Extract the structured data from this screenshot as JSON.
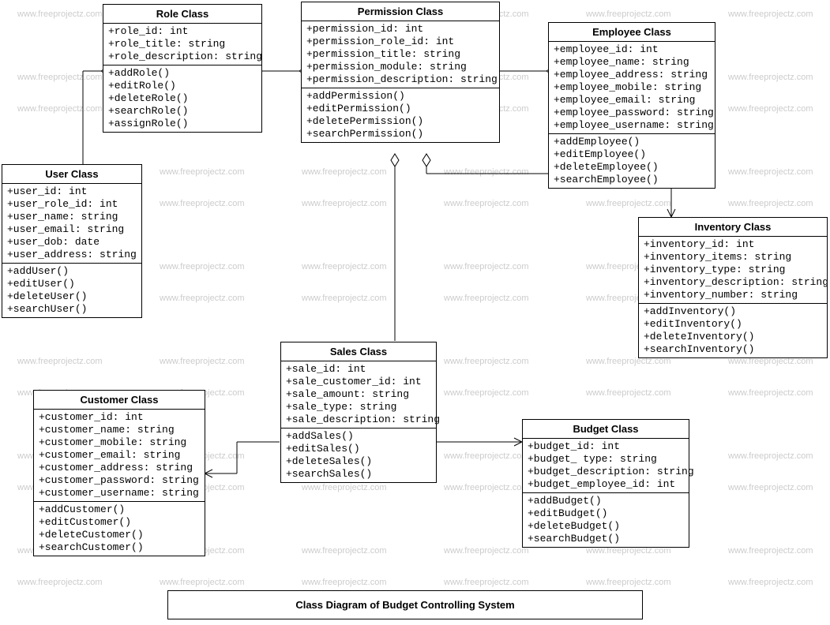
{
  "title": "Class Diagram of Budget Controlling System",
  "watermark": "www.freeprojectz.com",
  "classes": {
    "role": {
      "name": "Role Class",
      "attrs": [
        "+role_id: int",
        "+role_title: string",
        "+role_description: string"
      ],
      "ops": [
        "+addRole()",
        "+editRole()",
        "+deleteRole()",
        "+searchRole()",
        "+assignRole()"
      ]
    },
    "permission": {
      "name": "Permission Class",
      "attrs": [
        "+permission_id: int",
        "+permission_role_id: int",
        "+permission_title: string",
        "+permission_module: string",
        "+permission_description: string"
      ],
      "ops": [
        "+addPermission()",
        "+editPermission()",
        "+deletePermission()",
        "+searchPermission()"
      ]
    },
    "employee": {
      "name": "Employee Class",
      "attrs": [
        "+employee_id: int",
        "+employee_name: string",
        "+employee_address: string",
        "+employee_mobile: string",
        "+employee_email: string",
        "+employee_password: string",
        "+employee_username: string"
      ],
      "ops": [
        "+addEmployee()",
        "+editEmployee()",
        "+deleteEmployee()",
        "+searchEmployee()"
      ]
    },
    "user": {
      "name": "User Class",
      "attrs": [
        "+user_id: int",
        "+user_role_id: int",
        "+user_name: string",
        "+user_email: string",
        "+user_dob: date",
        "+user_address: string"
      ],
      "ops": [
        "+addUser()",
        "+editUser()",
        "+deleteUser()",
        "+searchUser()"
      ]
    },
    "inventory": {
      "name": "Inventory Class",
      "attrs": [
        "+inventory_id: int",
        "+inventory_items: string",
        "+inventory_type: string",
        "+inventory_description: string",
        "+inventory_number: string"
      ],
      "ops": [
        "+addInventory()",
        "+editInventory()",
        "+deleteInventory()",
        "+searchInventory()"
      ]
    },
    "sales": {
      "name": "Sales Class",
      "attrs": [
        "+sale_id: int",
        "+sale_customer_id: int",
        "+sale_amount: string",
        "+sale_type: string",
        "+sale_description: string"
      ],
      "ops": [
        "+addSales()",
        "+editSales()",
        "+deleteSales()",
        "+searchSales()"
      ]
    },
    "customer": {
      "name": "Customer Class",
      "attrs": [
        "+customer_id: int",
        "+customer_name: string",
        "+customer_mobile: string",
        "+customer_email: string",
        "+customer_address: string",
        "+customer_password: string",
        "+customer_username: string"
      ],
      "ops": [
        "+addCustomer()",
        "+editCustomer()",
        "+deleteCustomer()",
        "+searchCustomer()"
      ]
    },
    "budget": {
      "name": "Budget Class",
      "attrs": [
        "+budget_id: int",
        "+budget_ type: string",
        "+budget_description: string",
        "+budget_employee_id: int"
      ],
      "ops": [
        "+addBudget()",
        "+editBudget()",
        "+deleteBudget()",
        "+searchBudget()"
      ]
    }
  }
}
